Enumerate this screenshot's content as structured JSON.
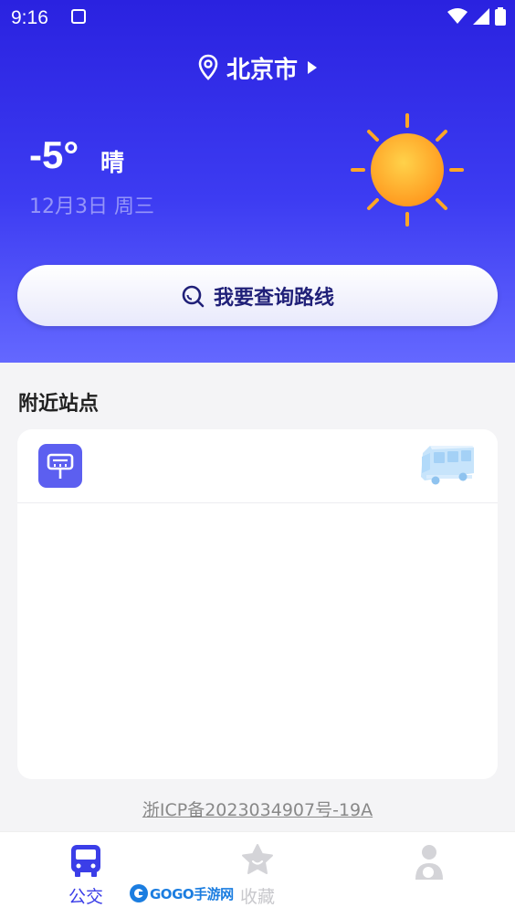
{
  "status_bar": {
    "time": "9:16"
  },
  "header": {
    "city": "北京市",
    "temperature": "-5°",
    "condition": "晴",
    "date": "12月3日 周三"
  },
  "search": {
    "label": "我要查询路线"
  },
  "nearby": {
    "title": "附近站点"
  },
  "footer": {
    "icp": "浙ICP备2023034907号-19A"
  },
  "tabs": [
    {
      "label": "公交",
      "active": true,
      "icon": "bus-icon"
    },
    {
      "label": "收藏",
      "active": false,
      "icon": "star-icon"
    },
    {
      "label": "",
      "active": false,
      "icon": "user-icon"
    }
  ],
  "watermark": {
    "text": "GOGO手游网"
  },
  "colors": {
    "header_top": "#2a22e0",
    "header_bottom": "#6468ff",
    "accent": "#3b3ee8",
    "sun": "#ffa51f"
  }
}
